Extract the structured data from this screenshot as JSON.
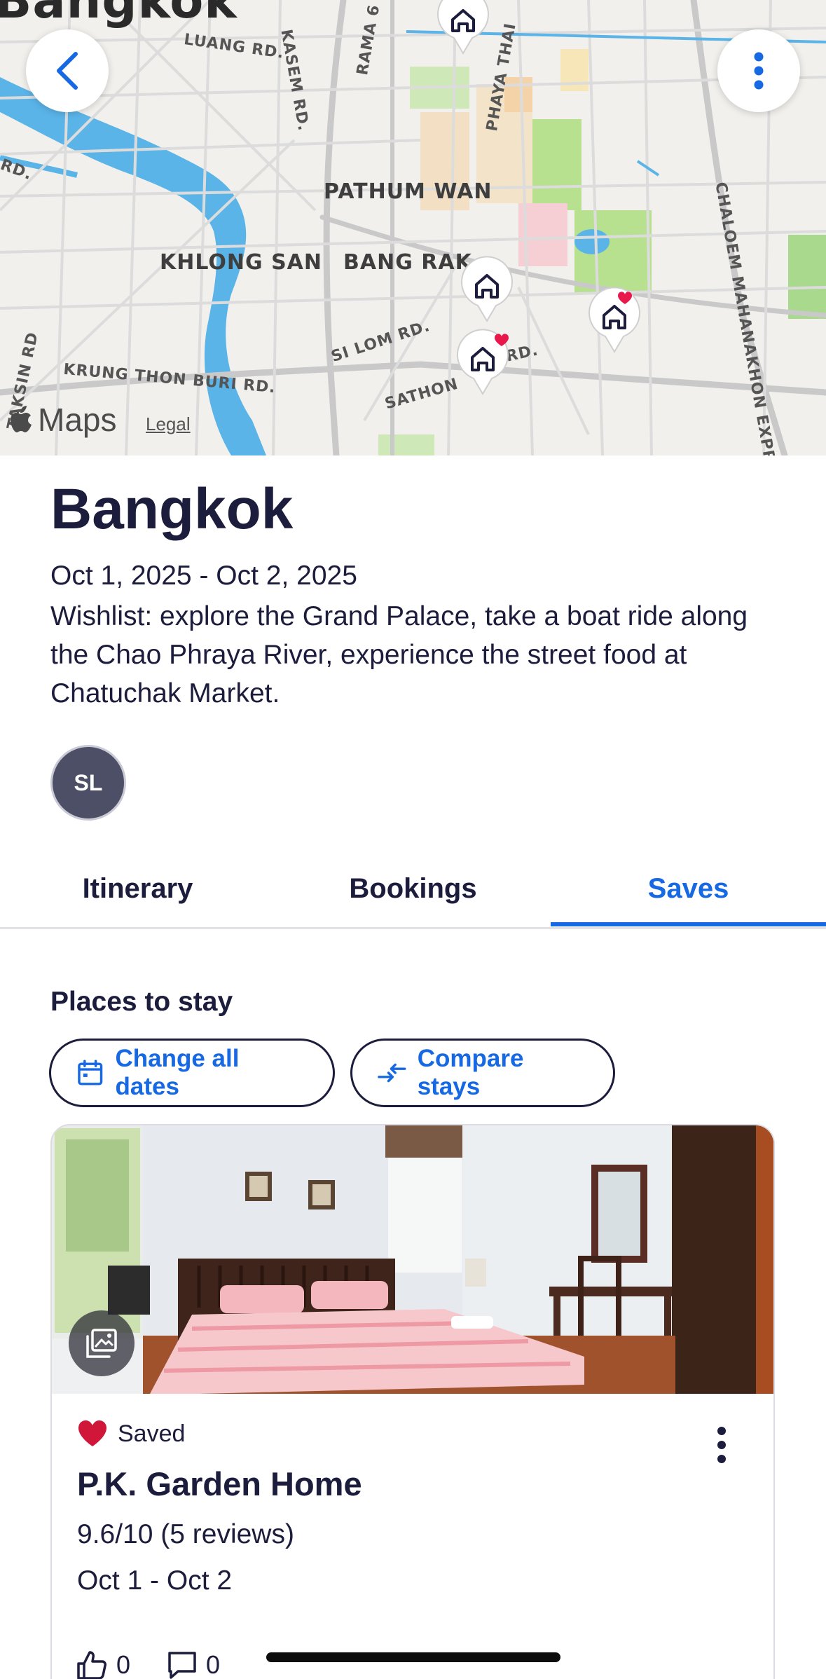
{
  "map": {
    "city_label": "Bangkok",
    "districts": [
      "PATHUM WAN",
      "KHLONG SAN",
      "BANG RAK"
    ],
    "roads": [
      "LUANG RD.",
      "KASEM RD.",
      "RAMA 6",
      "PHAYA THAI",
      "SI LOM RD.",
      "SATHON",
      "RD.",
      "KRUNG THON BURI RD.",
      "TAKSIN RD",
      "RD.",
      "CHALOEM MAHANAKHON EXPRESSWAY"
    ],
    "attribution": {
      "brand": "Maps",
      "legal": "Legal"
    },
    "back_icon": "chevron-left-icon",
    "more_icon": "more-vertical-icon",
    "pin_icon": "home-pin-icon",
    "saved_badge_icon": "heart-icon"
  },
  "trip": {
    "title": "Bangkok",
    "dates": "Oct 1, 2025 - Oct 2, 2025",
    "description": "Wishlist: explore the Grand Palace, take a boat ride along the Chao Phraya River, experience the street food at Chatuchak Market.",
    "member_initials": "SL"
  },
  "tabs": [
    {
      "label": "Itinerary",
      "active": false
    },
    {
      "label": "Bookings",
      "active": false
    },
    {
      "label": "Saves",
      "active": true
    }
  ],
  "saves": {
    "section_title": "Places to stay",
    "change_dates_label": "Change all dates",
    "compare_label": "Compare stays",
    "card": {
      "saved_label": "Saved",
      "name": "P.K. Garden Home",
      "rating": "9.6/10 (5 reviews)",
      "dates": "Oct 1 - Oct 2",
      "likes": "0",
      "comments": "0"
    }
  },
  "colors": {
    "accent": "#1668e3",
    "text": "#1c1c3c",
    "heart": "#d0173a",
    "avatar_bg": "#4d4f66",
    "map_water": "#5ab4e8",
    "map_park": "#a9d98c"
  }
}
